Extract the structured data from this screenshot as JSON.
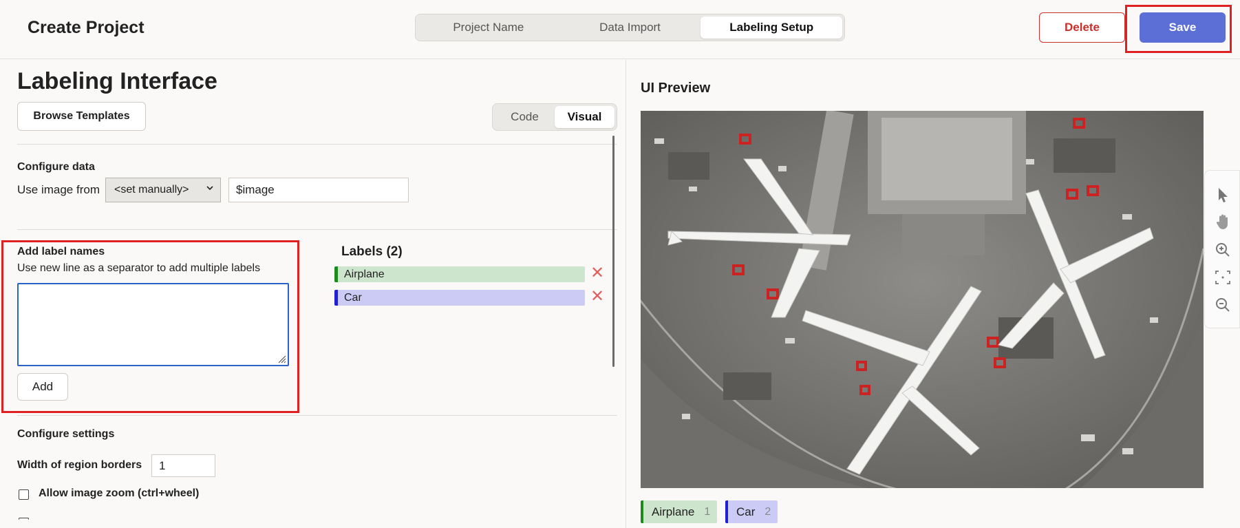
{
  "app": {
    "title": "Create Project"
  },
  "steps": [
    {
      "label": "Project Name"
    },
    {
      "label": "Data Import"
    },
    {
      "label": "Labeling Setup"
    }
  ],
  "header": {
    "delete_label": "Delete",
    "save_label": "Save"
  },
  "editor": {
    "title": "Labeling Interface",
    "browse_label": "Browse Templates",
    "mode_code": "Code",
    "mode_visual": "Visual",
    "configure_data": {
      "heading": "Configure data",
      "use_image_from": "Use image from",
      "select_value": "<set manually>",
      "image_field_value": "$image"
    },
    "add_labels": {
      "heading": "Add label names",
      "hint": "Use new line as a separator to add multiple labels",
      "textarea_value": "",
      "add_label": "Add"
    },
    "labels": {
      "heading": "Labels (2)",
      "items": [
        {
          "name": "Airplane",
          "color": "#1e8a1e",
          "bg": "#cde5cc"
        },
        {
          "name": "Car",
          "color": "#2020d0",
          "bg": "#cccbf5"
        }
      ]
    },
    "settings": {
      "heading": "Configure settings",
      "border_width_label": "Width of region borders",
      "border_width_value": "1",
      "zoom_label": "Allow image zoom (ctrl+wheel)"
    }
  },
  "preview": {
    "title": "UI Preview",
    "tools": [
      "pointer-icon",
      "hand-icon",
      "zoom-in-icon",
      "fit-icon",
      "zoom-out-icon"
    ],
    "legend": [
      {
        "name": "Airplane",
        "count": "1",
        "color": "#1e8a1e",
        "bg": "#cde5cc"
      },
      {
        "name": "Car",
        "count": "2",
        "color": "#2020d0",
        "bg": "#cccbf5"
      }
    ]
  }
}
